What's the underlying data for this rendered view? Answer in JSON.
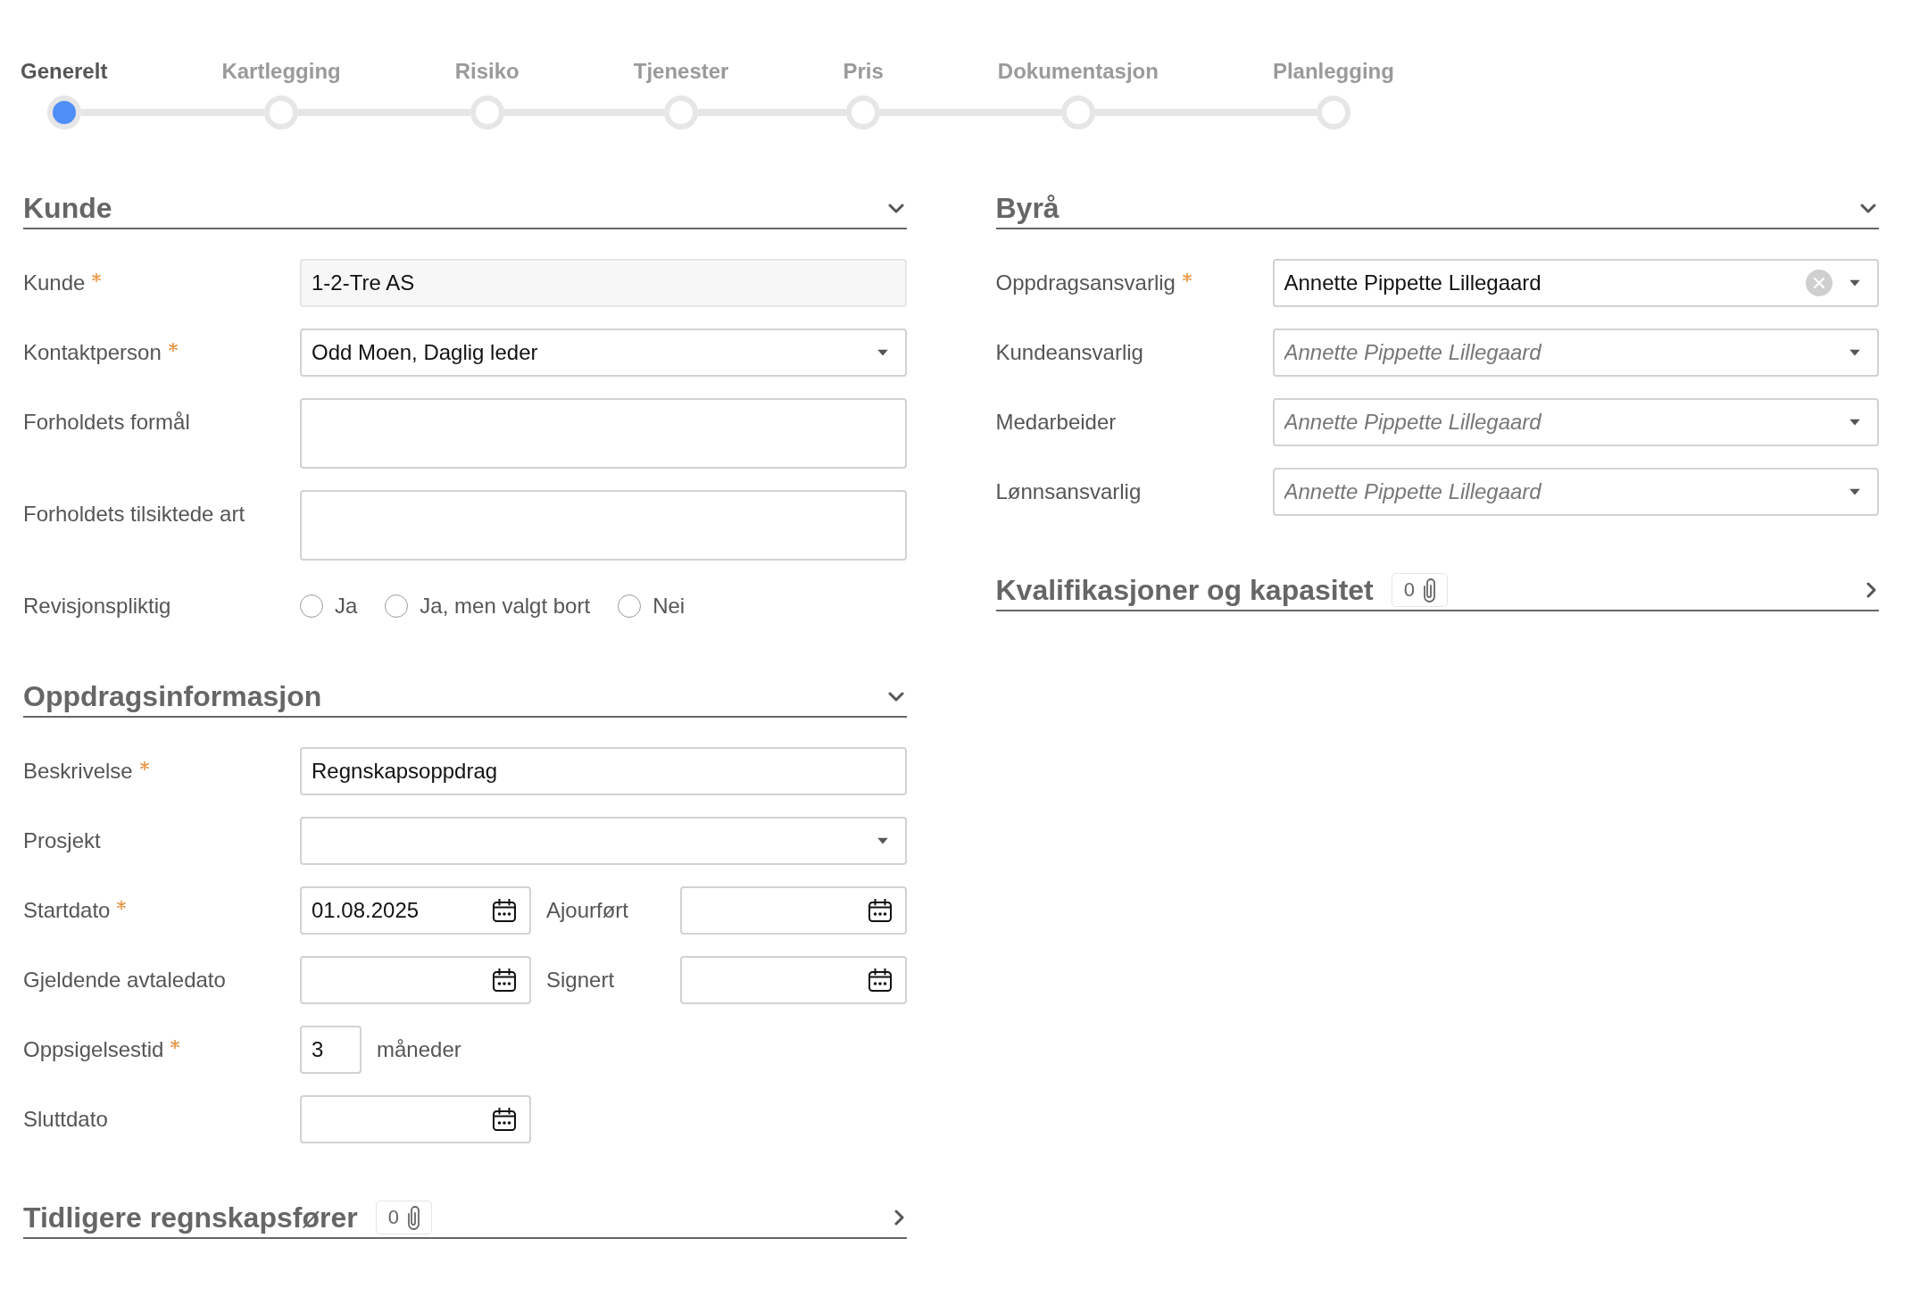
{
  "steps": [
    {
      "label": "Generelt",
      "selected": true
    },
    {
      "label": "Kartlegging",
      "selected": false
    },
    {
      "label": "Risiko",
      "selected": false
    },
    {
      "label": "Tjenester",
      "selected": false
    },
    {
      "label": "Pris",
      "selected": false
    },
    {
      "label": "Dokumentasjon",
      "selected": false
    },
    {
      "label": "Planlegging",
      "selected": false
    }
  ],
  "columns": [
    {
      "sections": [
        {
          "title": "Kunde",
          "expanded": true,
          "fields": [
            {
              "kind": "text",
              "label": "Kunde",
              "required": true,
              "value": "1-2-Tre AS",
              "readonly": true
            },
            {
              "kind": "select",
              "label": "Kontaktperson",
              "required": true,
              "value": "Odd Moen, Daglig leder",
              "clearable": false
            },
            {
              "kind": "textarea",
              "label": "Forholdets formål",
              "required": false
            },
            {
              "kind": "textarea",
              "label": "Forholdets tilsiktede art",
              "required": false
            },
            {
              "kind": "radio",
              "label": "Revisjonspliktig",
              "required": false,
              "options": [
                {
                  "label": "Ja",
                  "selected": false
                },
                {
                  "label": "Ja, men valgt bort",
                  "selected": false
                },
                {
                  "label": "Nei",
                  "selected": false
                }
              ]
            }
          ]
        },
        {
          "title": "Oppdragsinformasjon",
          "expanded": true,
          "fields": [
            {
              "kind": "text",
              "label": "Beskrivelse",
              "required": true,
              "value": "Regnskapsoppdrag",
              "readonly": false
            },
            {
              "kind": "select",
              "label": "Prosjekt",
              "required": false,
              "clearable": false
            },
            {
              "kind": "date",
              "label": "Startdato",
              "required": true,
              "value": "01.08.2025",
              "paired": {
                "label": "Ajourført",
                "required": false
              }
            },
            {
              "kind": "date",
              "label": "Gjeldende avtaledato",
              "required": false,
              "paired": {
                "label": "Signert",
                "required": false
              }
            },
            {
              "kind": "number",
              "label": "Oppsigelsestid",
              "required": true,
              "value": "3",
              "unit": "måneder"
            },
            {
              "kind": "date",
              "label": "Sluttdato",
              "required": false
            }
          ]
        },
        {
          "title": "Tidligere regnskapsfører",
          "expanded": false,
          "attachments": "0"
        }
      ]
    },
    {
      "sections": [
        {
          "title": "Byrå",
          "expanded": true,
          "fields": [
            {
              "kind": "select",
              "label": "Oppdragsansvarlig",
              "required": true,
              "value": "Annette Pippette Lillegaard",
              "clearable": true
            },
            {
              "kind": "select",
              "label": "Kundeansvarlig",
              "required": false,
              "placeholder": "Annette Pippette Lillegaard",
              "clearable": false
            },
            {
              "kind": "select",
              "label": "Medarbeider",
              "required": false,
              "placeholder": "Annette Pippette Lillegaard",
              "clearable": false
            },
            {
              "kind": "select",
              "label": "Lønnsansvarlig",
              "required": false,
              "placeholder": "Annette Pippette Lillegaard",
              "clearable": false
            }
          ]
        },
        {
          "title": "Kvalifikasjoner og kapasitet",
          "expanded": false,
          "attachments": "0"
        }
      ]
    }
  ]
}
